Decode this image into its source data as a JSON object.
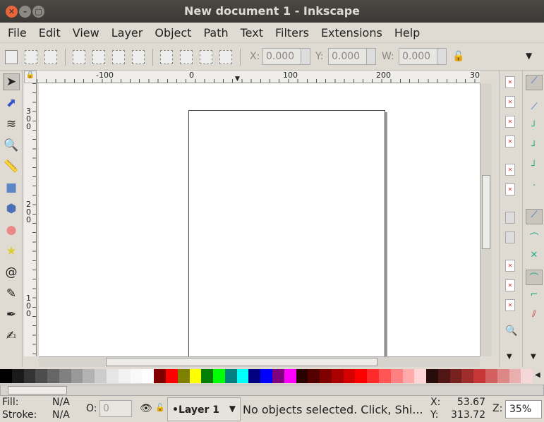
{
  "window": {
    "title": "New document 1 - Inkscape"
  },
  "menu": [
    "File",
    "Edit",
    "View",
    "Layer",
    "Object",
    "Path",
    "Text",
    "Filters",
    "Extensions",
    "Help"
  ],
  "toolbar": {
    "x_label": "X:",
    "x_value": "0.000",
    "y_label": "Y:",
    "y_value": "0.000",
    "w_label": "W:",
    "w_value": "0.000"
  },
  "tools": [
    "selector-icon",
    "node-icon",
    "tweak-icon",
    "zoom-icon",
    "measure-icon",
    "rectangle-icon",
    "3d-box-icon",
    "ellipse-icon",
    "star-icon",
    "spiral-icon",
    "pencil-icon",
    "pen-icon",
    "calligraphy-icon"
  ],
  "hruler": [
    "-100",
    "0",
    "100",
    "200",
    "30"
  ],
  "vruler": [
    "3\n0\n0",
    "2\n0\n0",
    "1\n0\n0"
  ],
  "palette": [
    "#000000",
    "#1a1a1a",
    "#333333",
    "#4d4d4d",
    "#666666",
    "#808080",
    "#999999",
    "#b3b3b3",
    "#cccccc",
    "#e6e6e6",
    "#f2f2f2",
    "#f9f9f9",
    "#ffffff",
    "#800000",
    "#ff0000",
    "#808000",
    "#ffff00",
    "#008000",
    "#00ff00",
    "#008080",
    "#00ffff",
    "#000080",
    "#0000ff",
    "#800080",
    "#ff00ff",
    "#2b0000",
    "#550000",
    "#800000",
    "#aa0000",
    "#d40000",
    "#ff0000",
    "#ff2a2a",
    "#ff5555",
    "#ff8080",
    "#ffaaaa",
    "#ffd5d5",
    "#280b0b",
    "#501616",
    "#782121",
    "#a02c2c",
    "#c83737",
    "#d35f5f",
    "#de8787",
    "#e9afaf",
    "#f4d7d7"
  ],
  "status": {
    "fill_label": "Fill:",
    "fill_value": "N/A",
    "stroke_label": "Stroke:",
    "stroke_value": "N/A",
    "opacity_label": "O:",
    "opacity_value": "0",
    "layer": "•Layer 1",
    "message": "No objects selected. Click, Shi...",
    "x_label": "X:",
    "x_value": "53.67",
    "y_label": "Y:",
    "y_value": "313.72",
    "zoom_label": "Z:",
    "zoom_value": "35%"
  }
}
